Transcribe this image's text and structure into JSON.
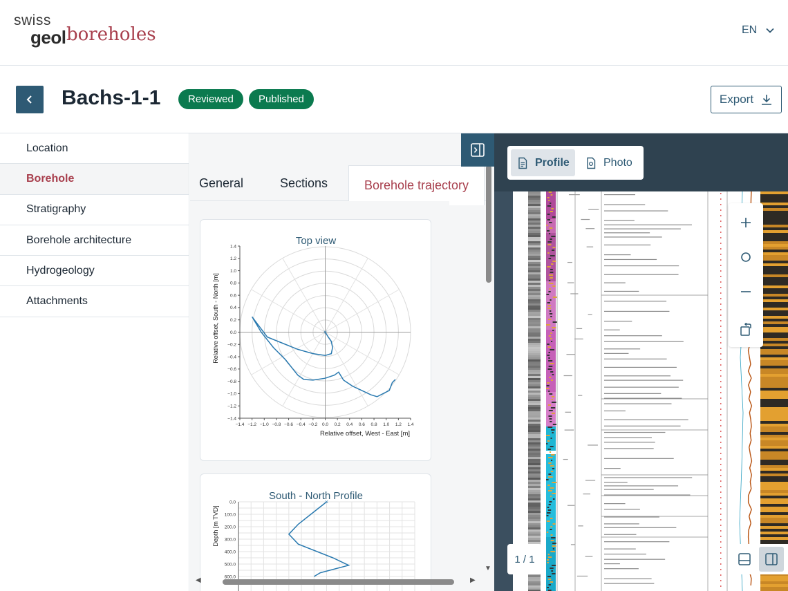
{
  "header": {
    "logo_swiss": "swiss",
    "logo_geol": "geol",
    "logo_boreholes": "boreholes",
    "language": "EN"
  },
  "title_row": {
    "title": "Bachs-1-1",
    "badges": [
      "Reviewed",
      "Published"
    ],
    "export_label": "Export"
  },
  "sidebar": {
    "items": [
      {
        "label": "Location",
        "active": false
      },
      {
        "label": "Borehole",
        "active": true
      },
      {
        "label": "Stratigraphy",
        "active": false
      },
      {
        "label": "Borehole architecture",
        "active": false
      },
      {
        "label": "Hydrogeology",
        "active": false
      },
      {
        "label": "Attachments",
        "active": false
      }
    ]
  },
  "tabs": [
    "General",
    "Sections",
    "Borehole trajectory"
  ],
  "active_tab": "Borehole trajectory",
  "viewer": {
    "mode_buttons": [
      "Profile",
      "Photo"
    ],
    "active_mode": "Profile",
    "page_indicator": "1 / 1"
  },
  "colors": {
    "primary": "#2e5a74",
    "accent": "#a83f4d",
    "badge": "#0b7a4f",
    "trajectory": "#2a7ab0"
  },
  "chart_data": [
    {
      "type": "line",
      "title": "Top view",
      "xlabel": "Relative offset, West - East [m]",
      "ylabel": "Relative offset, South - North [m]",
      "xlim": [
        -1.4,
        1.4
      ],
      "ylim": [
        -1.4,
        1.4
      ],
      "xticks": [
        "−1.4",
        "−1.2",
        "−1.0",
        "−0.8",
        "−0.6",
        "−0.4",
        "−0.2",
        "0.0",
        "0.2",
        "0.4",
        "0.6",
        "0.8",
        "1.0",
        "1.2",
        "1.4"
      ],
      "yticks": [
        "1.4",
        "1.2",
        "1.0",
        "0.8",
        "0.6",
        "0.4",
        "0.2",
        "0.0",
        "−0.2",
        "−0.4",
        "−0.6",
        "−0.8",
        "−1.0",
        "−1.2",
        "−1.4"
      ],
      "grid": "polar",
      "series": [
        {
          "x": [
            0.0,
            0.05,
            0.1,
            0.12,
            0.1,
            0.0,
            -0.2,
            -0.45,
            -0.7,
            -0.95,
            -1.2,
            -1.05,
            -0.85,
            -0.65,
            -0.45,
            -0.35,
            -0.2,
            0.0,
            0.15,
            0.22,
            0.3,
            0.45,
            0.6,
            0.75,
            0.85,
            0.95,
            1.05,
            1.1,
            1.15
          ],
          "y": [
            0.0,
            -0.08,
            -0.15,
            -0.25,
            -0.35,
            -0.38,
            -0.35,
            -0.28,
            -0.18,
            -0.08,
            0.25,
            0.0,
            -0.25,
            -0.45,
            -0.7,
            -0.77,
            -0.78,
            -0.75,
            -0.7,
            -0.65,
            -0.78,
            -0.88,
            -0.95,
            -1.02,
            -1.05,
            -1.0,
            -0.95,
            -0.82,
            -0.77
          ]
        }
      ]
    },
    {
      "type": "line",
      "title": "South - North Profile",
      "xlabel": "",
      "ylabel": "Depth [m TVD]",
      "ylim": [
        0,
        600
      ],
      "yticks": [
        "0.0",
        "100.0",
        "200.0",
        "300.0",
        "400.0",
        "500.0",
        "600.0"
      ],
      "series": [
        {
          "x": [
            0.0,
            -0.25,
            -0.45,
            -0.6,
            -0.45,
            0.1,
            0.35,
            -0.1,
            -0.2
          ],
          "y": [
            0,
            100,
            180,
            260,
            340,
            450,
            510,
            570,
            600
          ]
        }
      ]
    }
  ]
}
